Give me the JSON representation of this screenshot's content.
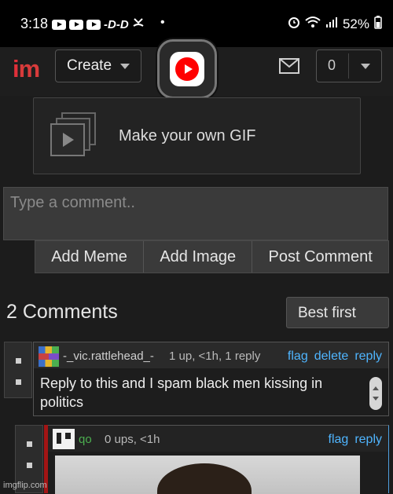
{
  "status_bar": {
    "time": "3:18",
    "notif_glyphs": "-D-D",
    "dot": "•",
    "battery": "52%"
  },
  "header": {
    "logo_i": "i",
    "logo_m": "m",
    "create_label": "Create",
    "notification_count": "0"
  },
  "gif_card": {
    "label": "Make your own GIF"
  },
  "comment_form": {
    "placeholder": "Type a comment..",
    "buttons": [
      "Add Meme",
      "Add Image",
      "Post Comment"
    ]
  },
  "comments_section": {
    "title": "2 Comments",
    "sort_label": "Best first"
  },
  "comments": [
    {
      "username": "-_vic.rattlehead_-",
      "meta": "1 up, <1h, 1 reply",
      "actions": [
        "flag",
        "delete",
        "reply"
      ],
      "text": "Reply to this and I spam black men kissing in politics"
    },
    {
      "username": "qo",
      "meta": "0 ups, <1h",
      "actions": [
        "flag",
        "reply"
      ]
    }
  ],
  "watermark": "imgflip.com",
  "colors": {
    "link": "#4fb5ff",
    "brand": "#e0303a",
    "reply_bar": "#a31515",
    "username_green": "#4caf50"
  }
}
